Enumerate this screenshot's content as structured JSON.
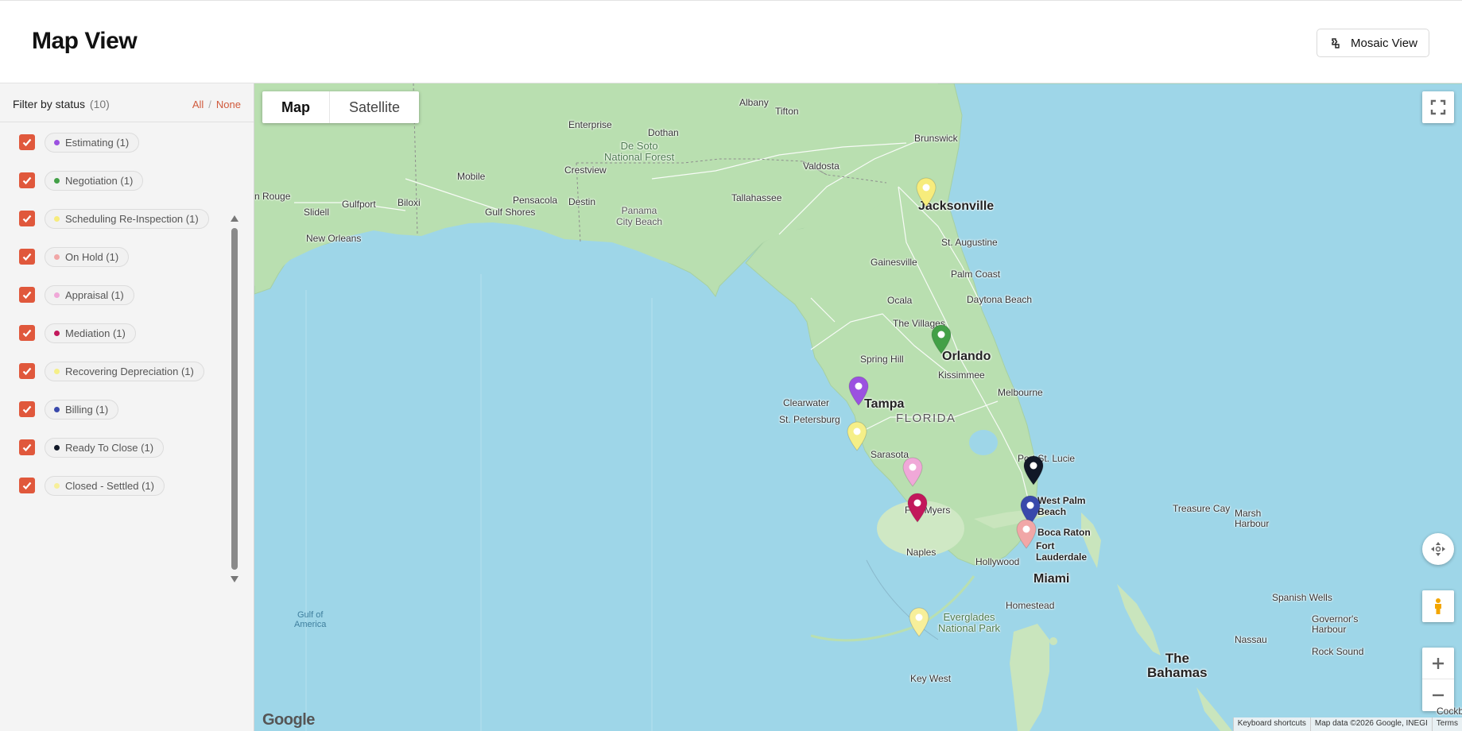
{
  "header": {
    "title": "Map View",
    "mosaic_label": "Mosaic View"
  },
  "filter": {
    "title": "Filter by status",
    "count": "(10)",
    "all_label": "All",
    "separator": "/",
    "none_label": "None",
    "statuses": [
      {
        "label": "Estimating (1)",
        "color": "#9b51e0",
        "checked": true
      },
      {
        "label": "Negotiation (1)",
        "color": "#43a047",
        "checked": true
      },
      {
        "label": "Scheduling Re-Inspection (1)",
        "color": "#f7ec7c",
        "checked": true
      },
      {
        "label": "On Hold (1)",
        "color": "#f1a7a7",
        "checked": true
      },
      {
        "label": "Appraisal (1)",
        "color": "#f0a8d8",
        "checked": true
      },
      {
        "label": "Mediation (1)",
        "color": "#c2185b",
        "checked": true
      },
      {
        "label": "Recovering Depreciation (1)",
        "color": "#f5ef88",
        "checked": true
      },
      {
        "label": "Billing (1)",
        "color": "#3949ab",
        "checked": true
      },
      {
        "label": "Ready To Close (1)",
        "color": "#111827",
        "checked": true
      },
      {
        "label": "Closed - Settled (1)",
        "color": "#f7ef9a",
        "checked": true
      }
    ]
  },
  "map": {
    "type_buttons": {
      "map": "Map",
      "satellite": "Satellite"
    },
    "google_logo": "Google",
    "attribution": {
      "shortcuts": "Keyboard shortcuts",
      "data": "Map data ©2026 Google, INEGI",
      "terms": "Terms"
    },
    "icons": {
      "fullscreen": "fullscreen-icon",
      "rotate": "rotate-icon",
      "pegman": "pegman-icon",
      "zoom_in": "plus-icon",
      "zoom_out": "minus-icon"
    },
    "labels": {
      "albany": "Albany",
      "tifton": "Tifton",
      "enterprise": "Enterprise",
      "dothan": "Dothan",
      "desoto": "De Soto\nNational Forest",
      "mobile": "Mobile",
      "crestview": "Crestview",
      "valdosta": "Valdosta",
      "brunswick": "Brunswick",
      "batonrouge": "n Rouge",
      "gulfport": "Gulfport",
      "biloxi": "Biloxi",
      "pensacola": "Pensacola",
      "destin": "Destin",
      "tallahassee": "Tallahassee",
      "jacksonville": "Jacksonville",
      "slidell": "Slidell",
      "gulfshores": "Gulf Shores",
      "panamacity": "Panama\nCity Beach",
      "neworleans": "New Orleans",
      "staugustine": "St. Augustine",
      "gainesville": "Gainesville",
      "palmcoast": "Palm Coast",
      "ocala": "Ocala",
      "daytona": "Daytona Beach",
      "villages": "The Villages",
      "orlando": "Orlando",
      "springhill": "Spring Hill",
      "kissimmee": "Kissimmee",
      "clearwater": "Clearwater",
      "tampa": "Tampa",
      "melbourne": "Melbourne",
      "stpete": "St. Petersburg",
      "florida": "FLORIDA",
      "sarasota": "Sarasota",
      "portstlucie": "Port St. Lucie",
      "westpalm": "West Palm\nBeach",
      "fortmyers": "Fort Myers",
      "treasurecay": "Treasure Cay",
      "marshharbour": "Marsh\nHarbour",
      "bocaraton": "Boca Raton",
      "naples": "Naples",
      "fortlauderdale": "Fort\nLauderdale",
      "hollywood": "Hollywood",
      "miami": "Miami",
      "spanishwells": "Spanish Wells",
      "homestead": "Homestead",
      "governors": "Governor's\nHarbour",
      "everglades": "Everglades\nNational Park",
      "gulfofamerica": "Gulf of\nAmerica",
      "nassau": "Nassau",
      "rocksound": "Rock Sound",
      "bahamas": "The\nBahamas",
      "keywest": "Key West",
      "cockburn": "Cockb"
    },
    "pins": [
      {
        "status": "Scheduling Re-Inspection",
        "color": "#f7ec7c"
      },
      {
        "status": "Negotiation",
        "color": "#43a047"
      },
      {
        "status": "Estimating",
        "color": "#9b51e0"
      },
      {
        "status": "Recovering Depreciation",
        "color": "#f5ef88"
      },
      {
        "status": "Appraisal",
        "color": "#f0a8d8"
      },
      {
        "status": "Ready To Close",
        "color": "#111827"
      },
      {
        "status": "Mediation",
        "color": "#c2185b"
      },
      {
        "status": "Billing",
        "color": "#3949ab"
      },
      {
        "status": "On Hold",
        "color": "#f1a7a7"
      },
      {
        "status": "Closed - Settled",
        "color": "#f7ef9a"
      }
    ]
  }
}
